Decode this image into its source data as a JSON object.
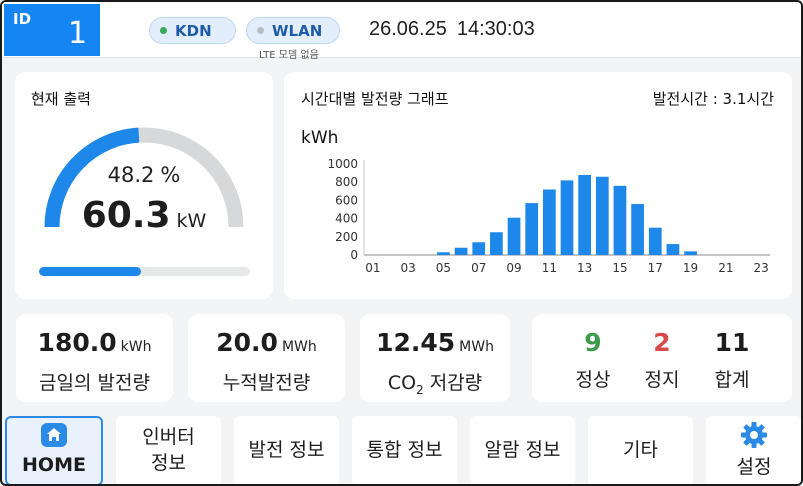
{
  "header": {
    "id_label": "ID",
    "id_value": "1",
    "status": [
      {
        "label": "KDN",
        "state": "connected",
        "color": "#34a853"
      },
      {
        "label": "WLAN",
        "state": "inactive",
        "color": "#b7bcc2"
      }
    ],
    "lte_note": "LTE 모뎀 없음",
    "date": "26.06.25",
    "time": "14:30:03"
  },
  "output": {
    "title": "현재 출력",
    "percent": "48.2",
    "percent_unit": "%",
    "power": "60.3",
    "power_unit": "kW",
    "gauge_fraction": 0.482,
    "bar_fraction": 0.482,
    "accent": "#1d88ea"
  },
  "chart": {
    "title": "시간대별 발전량 그래프",
    "gen_time": "발전시간 : 3.1시간",
    "unit": "kWh"
  },
  "chart_data": {
    "type": "bar",
    "categories": [
      "01",
      "02",
      "03",
      "04",
      "05",
      "06",
      "07",
      "08",
      "09",
      "10",
      "11",
      "12",
      "13",
      "14",
      "15",
      "16",
      "17",
      "18",
      "19",
      "20",
      "21",
      "22",
      "23"
    ],
    "tick_labels": [
      "01",
      "03",
      "05",
      "07",
      "09",
      "11",
      "13",
      "15",
      "17",
      "19",
      "21",
      "23"
    ],
    "values": [
      0,
      0,
      0,
      0,
      30,
      80,
      140,
      250,
      410,
      570,
      720,
      820,
      880,
      860,
      760,
      560,
      300,
      120,
      40,
      0,
      0,
      0,
      0
    ],
    "ylim": [
      0,
      1000
    ],
    "yticks": [
      0,
      200,
      400,
      600,
      800,
      1000
    ],
    "ylabel": "kWh",
    "grid": false,
    "color": "#1d88ea"
  },
  "stats": [
    {
      "value": "180.0",
      "unit": "kWh",
      "label": "금일의 발전량"
    },
    {
      "value": "20.0",
      "unit": "MWh",
      "label": "누적발전량"
    },
    {
      "value": "12.45",
      "unit": "MWh",
      "label_main": "CO",
      "label_sub": "2",
      "label_rest": " 저감량"
    }
  ],
  "inverters": {
    "normal": {
      "value": "9",
      "label": "정상",
      "color": "#3e9a4c"
    },
    "stopped": {
      "value": "2",
      "label": "정지",
      "color": "#d84a4a"
    },
    "total": {
      "value": "11",
      "label": "합계"
    }
  },
  "nav": {
    "home": "HOME",
    "inverter_line1": "인버터",
    "inverter_line2": "정보",
    "generation": "발전 정보",
    "integrated": "통합 정보",
    "alarm": "알람 정보",
    "etc": "기타",
    "settings": "설정"
  }
}
